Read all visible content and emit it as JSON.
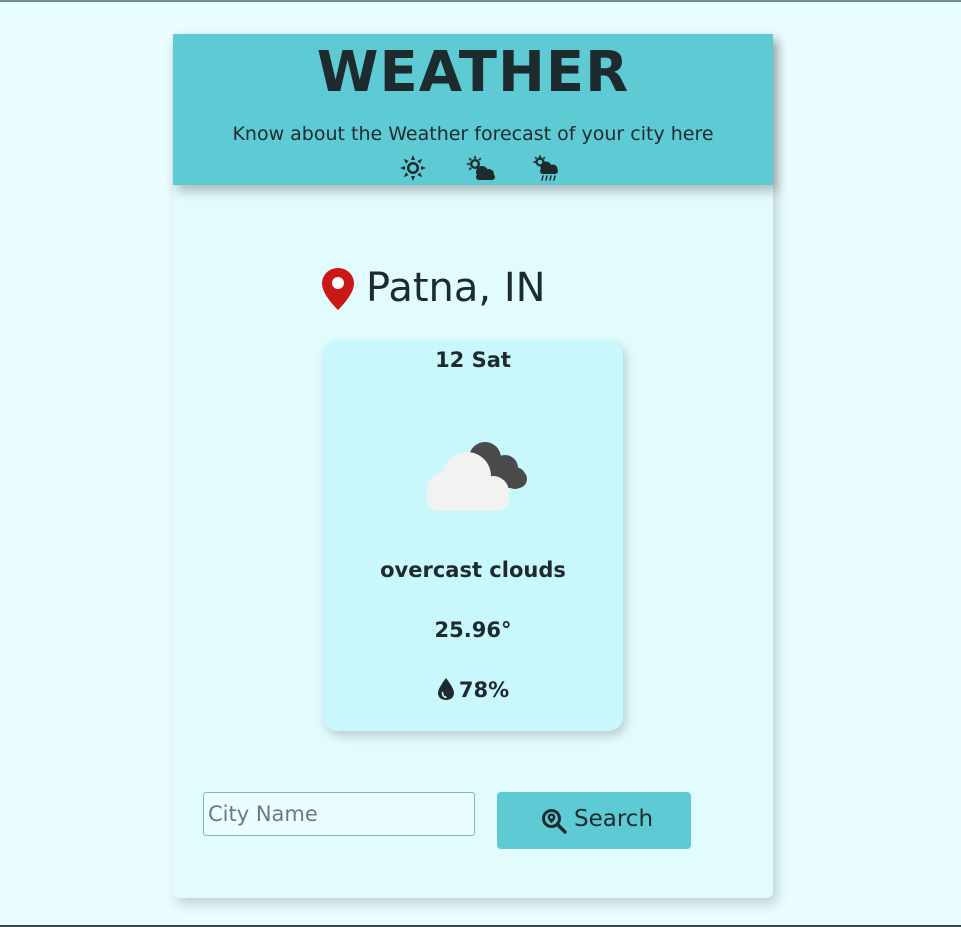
{
  "header": {
    "title": "WEATHER",
    "subtitle": "Know about the Weather forecast of your city here",
    "icons": [
      "sun-icon",
      "partly-cloudy-icon",
      "rain-icon"
    ]
  },
  "location": {
    "icon": "map-pin-icon",
    "text": "Patna, IN"
  },
  "forecast": {
    "date": "12 Sat",
    "icon": "overcast-clouds-icon",
    "description": "overcast clouds",
    "temperature": "25.96°",
    "humidity_icon": "water-drop-icon",
    "humidity": "78%"
  },
  "search": {
    "placeholder": "City Name",
    "value": "",
    "button_label": "Search",
    "button_icon": "location-search-icon"
  },
  "colors": {
    "page_background": "#e9fdfe",
    "header": "#5ecad4",
    "card": "#c8f8fc",
    "pin": "#cc1717",
    "text": "#1e2b2e"
  }
}
